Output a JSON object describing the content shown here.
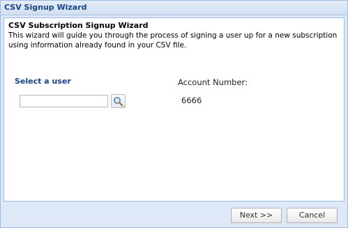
{
  "window": {
    "title": "CSV Signup Wizard"
  },
  "header": {
    "title": "CSV Subscription Signup Wizard",
    "description": "This wizard will guide you through the process of signing a user up for a new subscription using information already found in your CSV file."
  },
  "user_select": {
    "label": "Select a user",
    "value": "",
    "placeholder": ""
  },
  "account": {
    "label": "Account Number:",
    "value": "6666"
  },
  "buttons": {
    "next_label": "Next >>",
    "cancel_label": "Cancel"
  },
  "icons": {
    "search": "magnifier-icon"
  },
  "colors": {
    "title_text": "#15428b",
    "window_border": "#99bbe8",
    "window_background": "#dfe8f6"
  }
}
